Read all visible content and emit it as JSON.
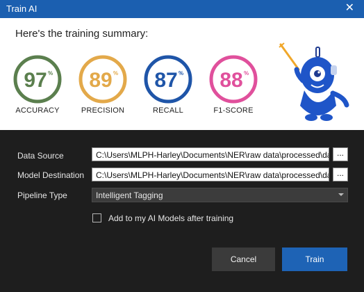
{
  "window": {
    "title": "Train AI",
    "close_glyph": "✕",
    "close_icon": "close-icon"
  },
  "summary": {
    "heading": "Here's the training summary:",
    "metrics": [
      {
        "value": "97",
        "unit": "%",
        "label": "ACCURACY",
        "color": "#5b7f4e"
      },
      {
        "value": "89",
        "unit": "%",
        "label": "PRECISION",
        "color": "#e3a94a"
      },
      {
        "value": "87",
        "unit": "%",
        "label": "RECALL",
        "color": "#1f55a8"
      },
      {
        "value": "88",
        "unit": "%",
        "label": "F1-SCORE",
        "color": "#e0509c"
      }
    ],
    "mascot_icon": "robot-mascot-icon"
  },
  "form": {
    "data_source": {
      "label": "Data Source",
      "value": "C:\\Users\\MLPH-Harley\\Documents\\NER\\raw data\\processed\\data",
      "browse_label": "..."
    },
    "model_destination": {
      "label": "Model Destination",
      "value": "C:\\Users\\MLPH-Harley\\Documents\\NER\\raw data\\processed\\data",
      "browse_label": "..."
    },
    "pipeline_type": {
      "label": "Pipeline Type",
      "selected": "Intelligent Tagging"
    },
    "add_to_models": {
      "label": "Add to my AI Models after training",
      "checked": false
    }
  },
  "buttons": {
    "cancel": "Cancel",
    "train": "Train"
  },
  "colors": {
    "title_bar": "#1b5fb0",
    "form_bg": "#1e1e1e",
    "train_button": "#1e63b5",
    "cancel_button": "#3b3b3b"
  }
}
